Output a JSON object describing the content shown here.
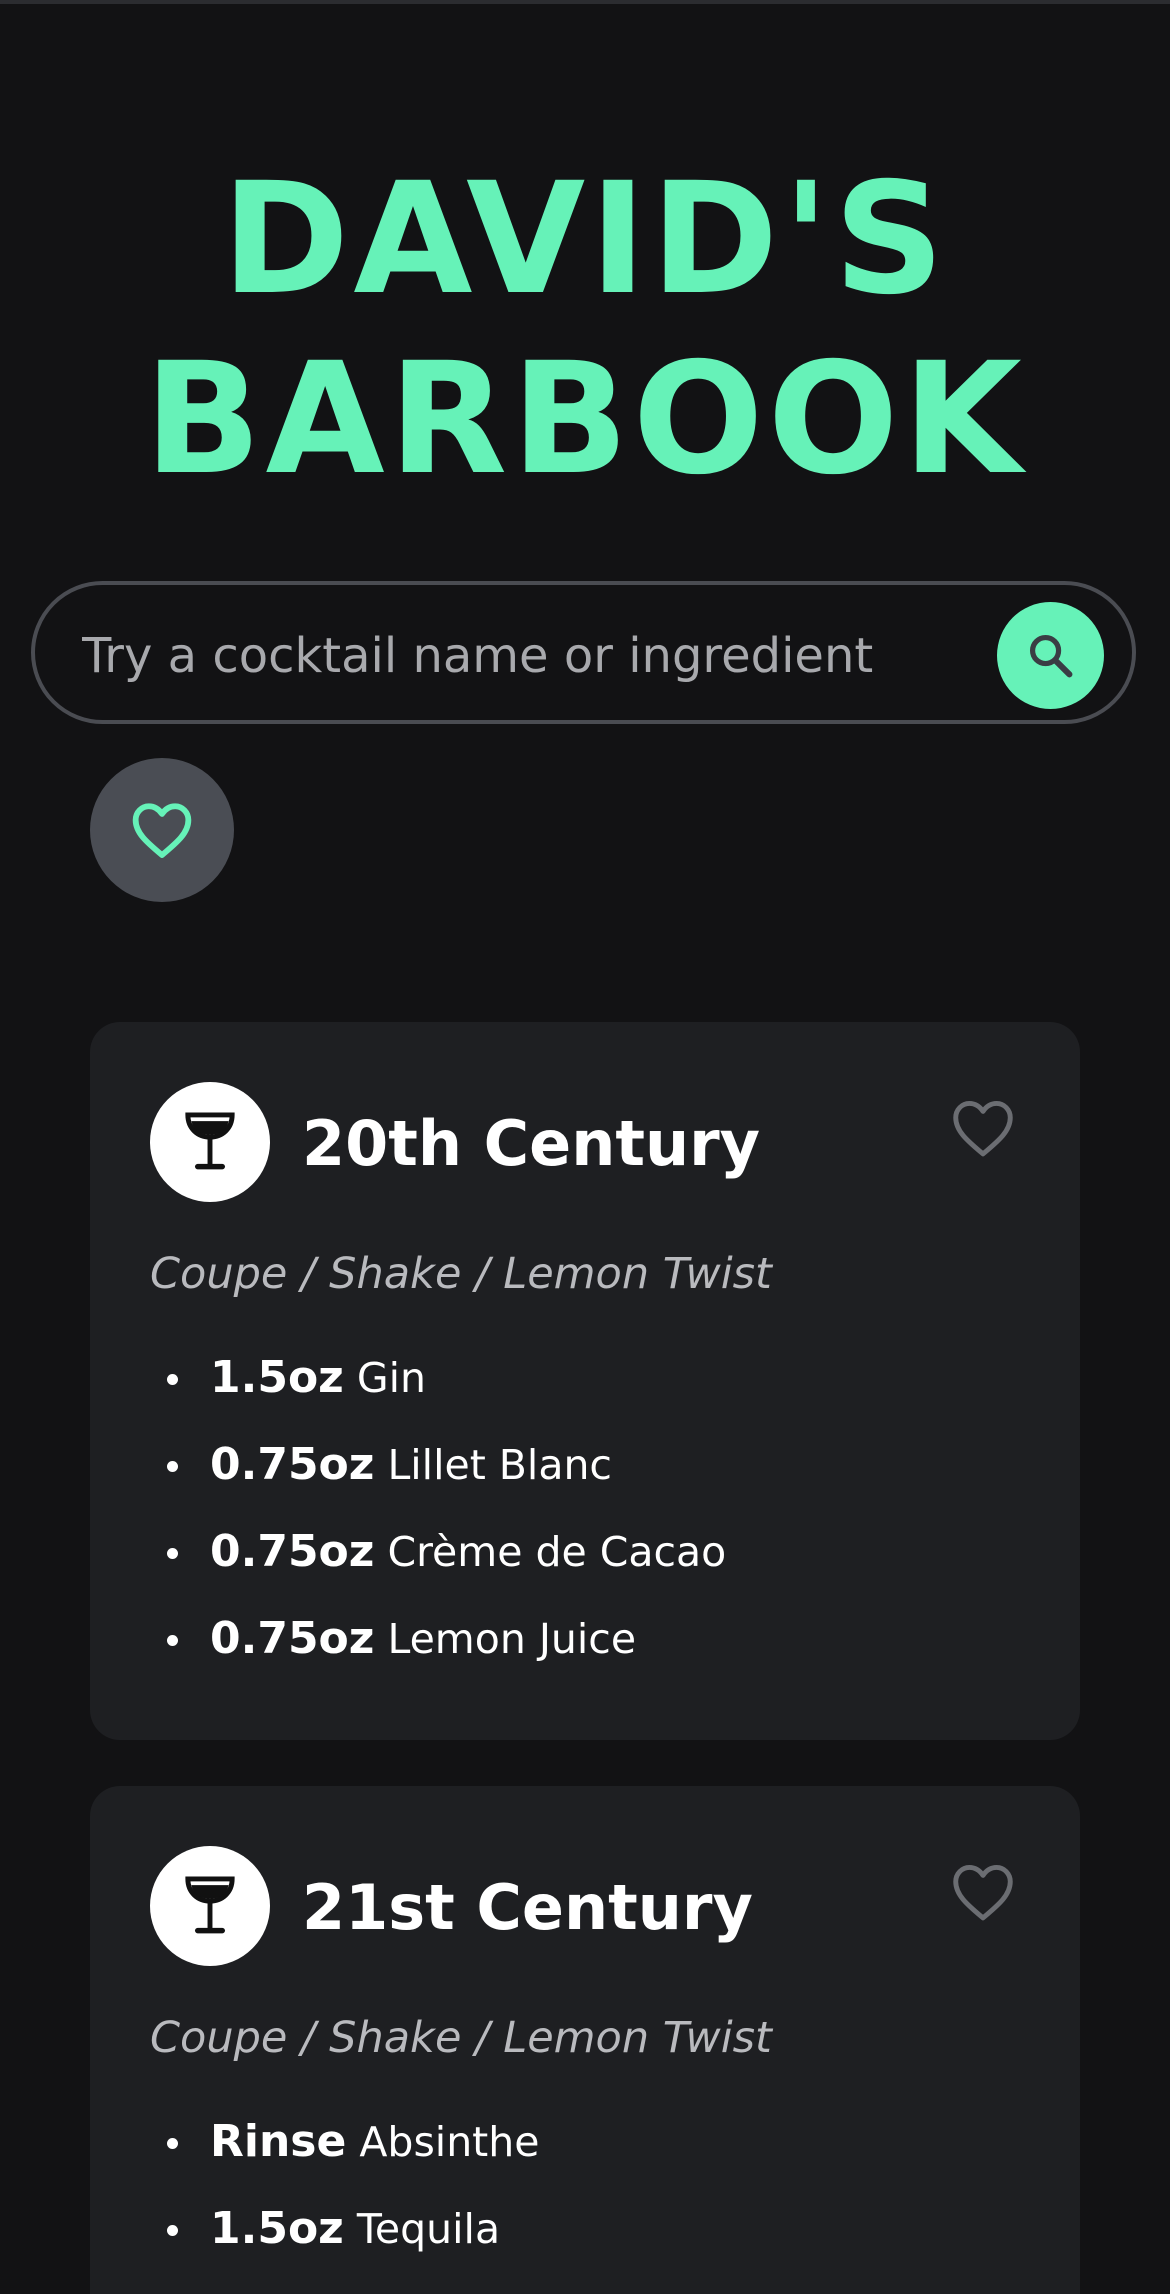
{
  "app": {
    "title": "DAVID'S BARBOOK"
  },
  "search": {
    "placeholder": "Try a cocktail name or ingredient",
    "value": "",
    "button_icon": "search-icon"
  },
  "favorites_toggle": {
    "icon": "heart-outline-icon"
  },
  "colors": {
    "accent": "#66f2b8",
    "background": "#121214",
    "card": "#1e1f22",
    "fav_button_bg": "#4a4d54"
  },
  "cocktails": [
    {
      "name": "20th Century",
      "icon": "coupe-glass-icon",
      "meta": "Coupe / Shake / Lemon Twist",
      "ingredients": [
        {
          "amount": "1.5oz",
          "name": "Gin"
        },
        {
          "amount": "0.75oz",
          "name": "Lillet Blanc"
        },
        {
          "amount": "0.75oz",
          "name": "Crème de Cacao"
        },
        {
          "amount": "0.75oz",
          "name": "Lemon Juice"
        }
      ]
    },
    {
      "name": "21st Century",
      "icon": "coupe-glass-icon",
      "meta": "Coupe / Shake / Lemon Twist",
      "ingredients": [
        {
          "amount": "Rinse",
          "name": "Absinthe"
        },
        {
          "amount": "1.5oz",
          "name": "Tequila"
        }
      ]
    }
  ]
}
